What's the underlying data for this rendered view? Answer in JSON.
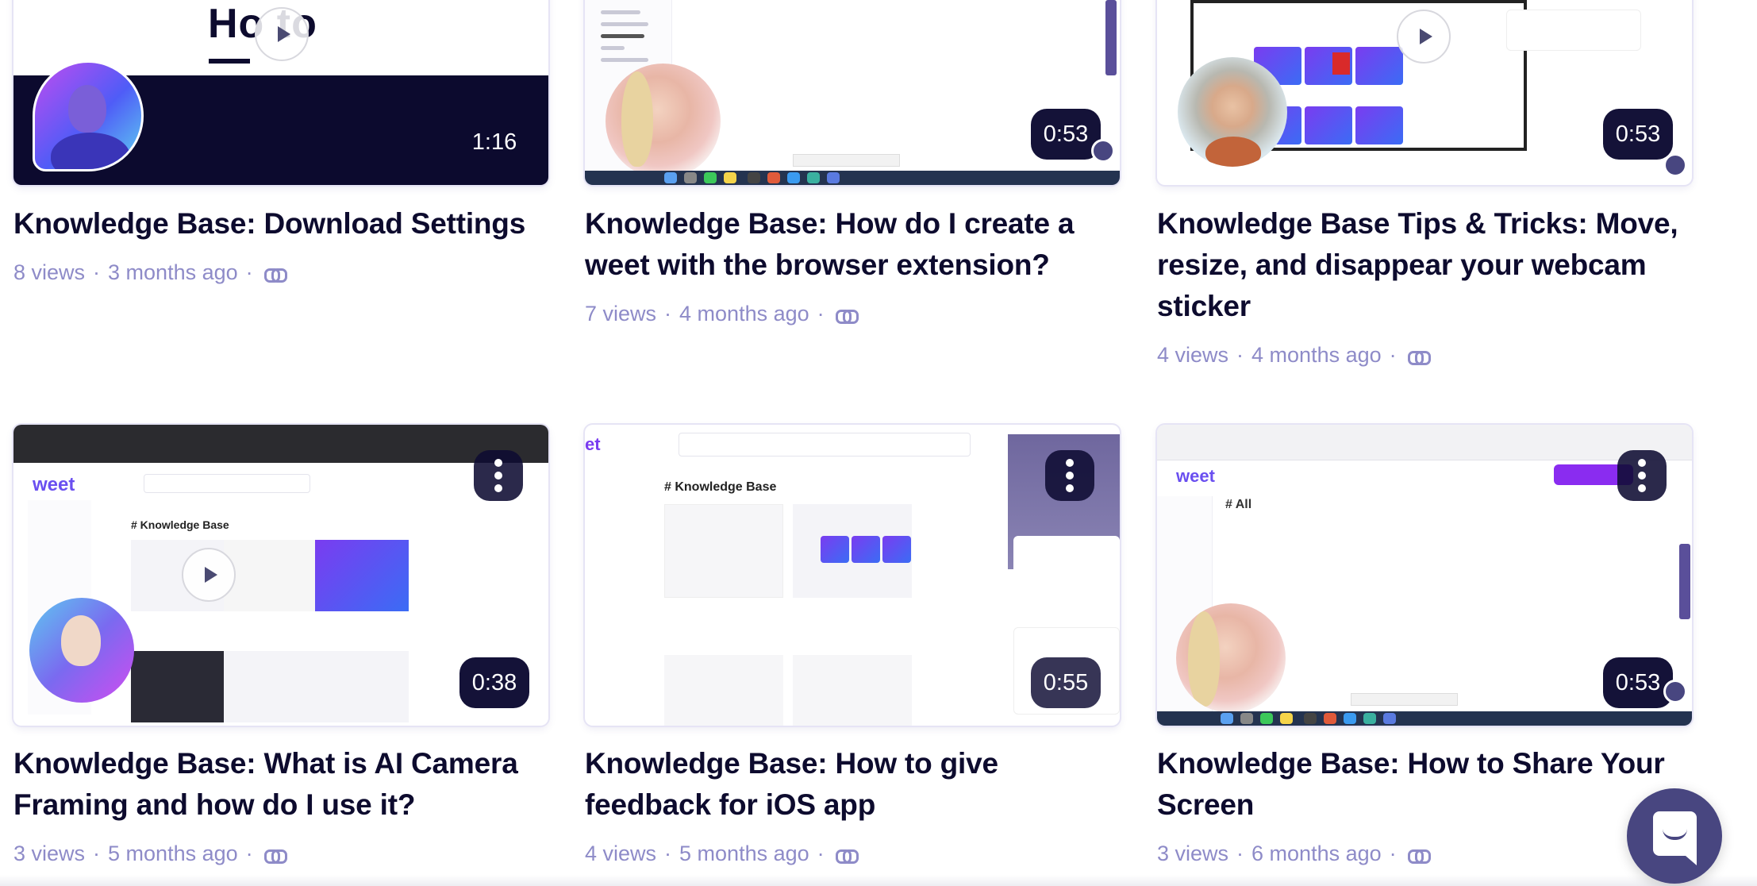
{
  "videos": [
    {
      "title": "Knowledge Base: Download Settings",
      "views": "8 views",
      "age": "3 months ago",
      "duration": "1:16",
      "thumb_text": "Ho  to"
    },
    {
      "title": "Knowledge Base: How do I create a weet with the browser extension?",
      "views": "7 views",
      "age": "4 months ago",
      "duration": "0:53"
    },
    {
      "title": "Knowledge Base Tips & Tricks: Move, resize, and disappear your webcam sticker",
      "views": "4 views",
      "age": "4 months ago",
      "duration": "0:53"
    },
    {
      "title": "Knowledge Base: What is AI Camera Framing and how do I use it?",
      "views": "3 views",
      "age": "5 months ago",
      "duration": "0:38"
    },
    {
      "title": "Knowledge Base: How to give feedback for iOS app",
      "views": "4 views",
      "age": "5 months ago",
      "duration": "0:55"
    },
    {
      "title": "Knowledge Base: How to Share Your Screen",
      "views": "3 views",
      "age": "6 months ago",
      "duration": "0:53"
    }
  ],
  "separator": "·",
  "icons": {
    "copy_link": "link-icon",
    "more_options": "more-vertical-icon",
    "play": "play-icon",
    "chat_launcher": "chat-bubble-icon"
  },
  "colors": {
    "title": "#0d0b2e",
    "meta": "#8e8bc8",
    "duration_badge": "#141238",
    "chat_launcher": "#484680"
  }
}
